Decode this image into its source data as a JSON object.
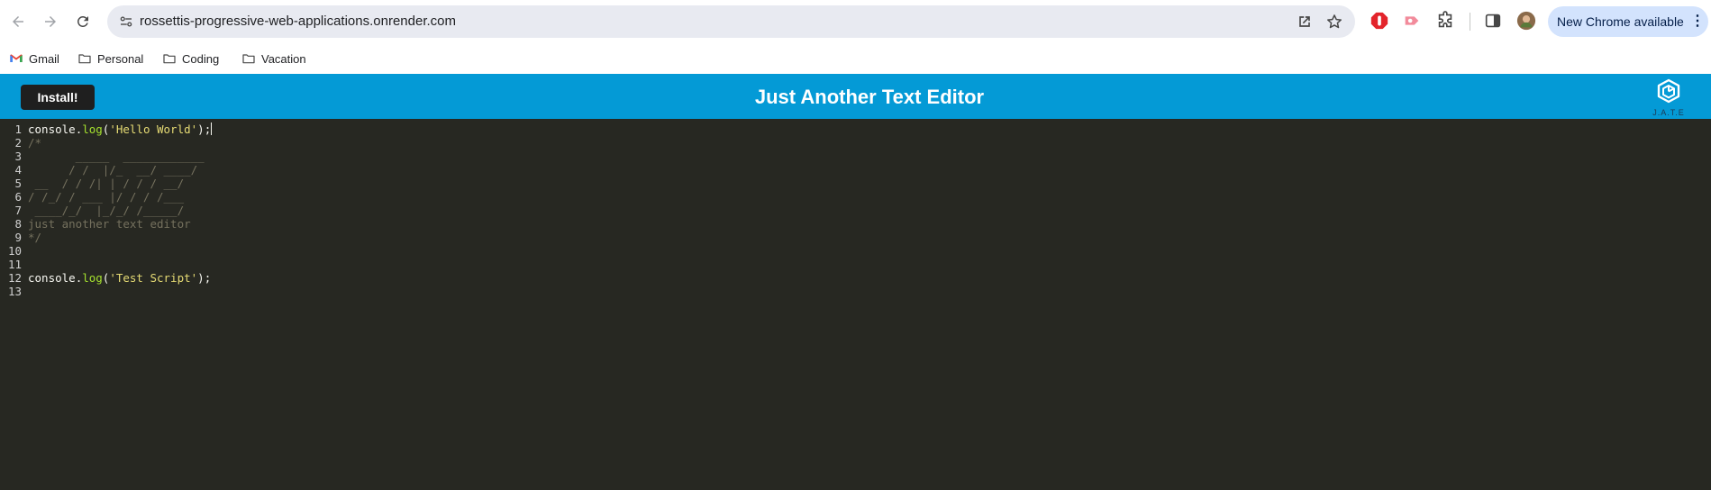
{
  "browser": {
    "url": "rossettis-progressive-web-applications.onrender.com",
    "update_label": "New Chrome available",
    "bookmarks": [
      {
        "label": "Gmail"
      },
      {
        "label": "Personal"
      },
      {
        "label": "Coding"
      },
      {
        "label": "Vacation"
      }
    ]
  },
  "app": {
    "title": "Just Another Text Editor",
    "install_label": "Install!",
    "logo_text": "J.A.T.E",
    "header_color": "#049ad6"
  },
  "editor": {
    "theme": "monokai",
    "lines": [
      {
        "num": "1",
        "tokens": [
          [
            "var",
            "console"
          ],
          [
            "punc",
            "."
          ],
          [
            "prop",
            "log"
          ],
          [
            "punc",
            "("
          ],
          [
            "str",
            "'Hello World'"
          ],
          [
            "punc",
            ");"
          ]
        ],
        "cursor": true
      },
      {
        "num": "2",
        "tokens": [
          [
            "com",
            "/*"
          ]
        ]
      },
      {
        "num": "3",
        "tokens": [
          [
            "com",
            "       _____  ____________"
          ]
        ]
      },
      {
        "num": "4",
        "tokens": [
          [
            "com",
            "      / /  |/_  __/ ____/"
          ]
        ]
      },
      {
        "num": "5",
        "tokens": [
          [
            "com",
            " __  / / /| | / / / __/"
          ]
        ]
      },
      {
        "num": "6",
        "tokens": [
          [
            "com",
            "/ /_/ / ___ |/ / / /___"
          ]
        ]
      },
      {
        "num": "7",
        "tokens": [
          [
            "com",
            " ____/_/  |_/_/ /_____/"
          ]
        ]
      },
      {
        "num": "8",
        "tokens": [
          [
            "com",
            "just another text editor"
          ]
        ]
      },
      {
        "num": "9",
        "tokens": [
          [
            "com",
            "*/"
          ]
        ]
      },
      {
        "num": "10",
        "tokens": []
      },
      {
        "num": "11",
        "tokens": []
      },
      {
        "num": "12",
        "tokens": [
          [
            "var",
            "console"
          ],
          [
            "punc",
            "."
          ],
          [
            "prop",
            "log"
          ],
          [
            "punc",
            "("
          ],
          [
            "str",
            "'Test Script'"
          ],
          [
            "punc",
            ");"
          ]
        ]
      },
      {
        "num": "13",
        "tokens": []
      }
    ]
  }
}
